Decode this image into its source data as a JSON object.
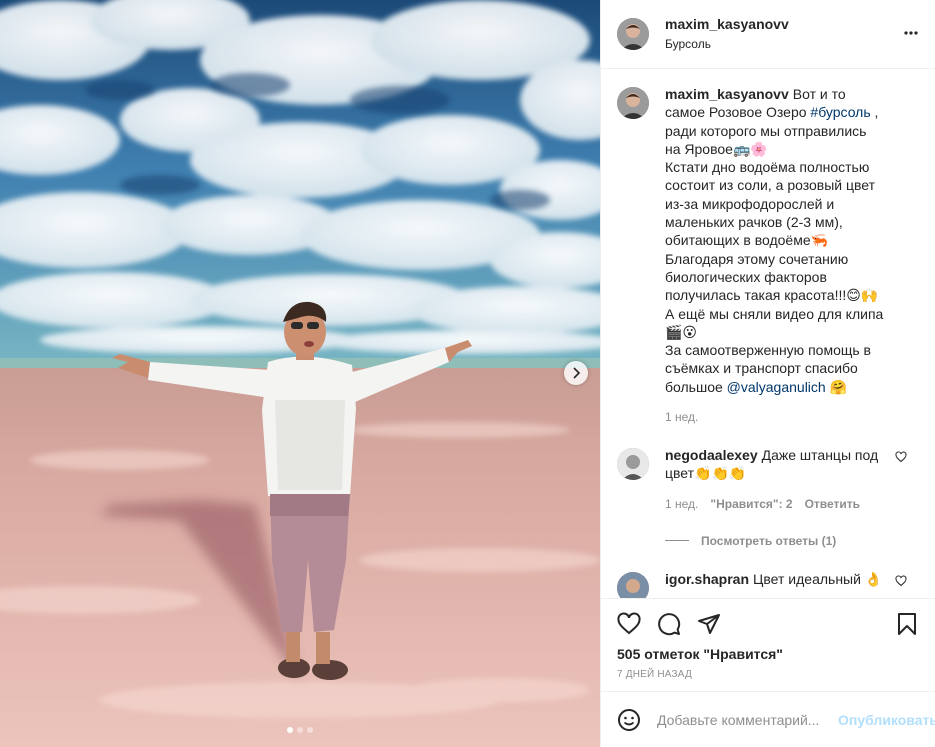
{
  "post": {
    "username": "maxim_kasyanovv",
    "location": "Бурсоль",
    "more_icon": "more-horizontal-icon"
  },
  "caption": {
    "username": "maxim_kasyanovv",
    "text_1": "Вот и то самое Розовое Озеро ",
    "hashtag": "#бурсоль",
    "text_2": " , ради которого мы отправились на Яровое🚌🌸",
    "line_2": "Кстати дно водоёма полностью состоит из соли, а розовый цвет из-за микрофодорослей и маленьких рачков (2-3 мм), обитающих в водоёме🦐",
    "line_3": "Благодаря этому сочетанию биологических факторов получилась такая красота!!!😊🙌",
    "line_4": "А ещё мы сняли видео для клипа🎬😮",
    "line_5": "За самоотверженную помощь в съёмках и транспорт спасибо большое ",
    "mention": "@valyaganulich",
    "line_5_end": " 🤗",
    "age": "1 нед."
  },
  "comments": [
    {
      "username": "negodaalexey",
      "text": "Даже штанцы под цвет👏👏👏",
      "age": "1 нед.",
      "likes": "\"Нравится\": 2",
      "reply": "Ответить",
      "view_replies": "Посмотреть ответы (1)"
    },
    {
      "username": "igor.shapran",
      "text": "Цвет идеальный 👌"
    }
  ],
  "actions": {
    "like_icon": "heart-icon",
    "comment_icon": "comment-icon",
    "share_icon": "paper-plane-icon",
    "save_icon": "bookmark-icon"
  },
  "likes_text": "505 отметок \"Нравится\"",
  "timestamp": "7 дней назад",
  "composer": {
    "placeholder": "Добавьте комментарий...",
    "post_label": "Опубликовать",
    "emoji_icon": "smiley-icon"
  },
  "carousel": {
    "total": 3,
    "current": 1,
    "next_icon": "chevron-right-icon"
  },
  "colors": {
    "text": "#262626",
    "secondary": "#8e8e8e",
    "link": "#00376b",
    "post_disabled": "#b2dffc",
    "border": "#efefef"
  }
}
